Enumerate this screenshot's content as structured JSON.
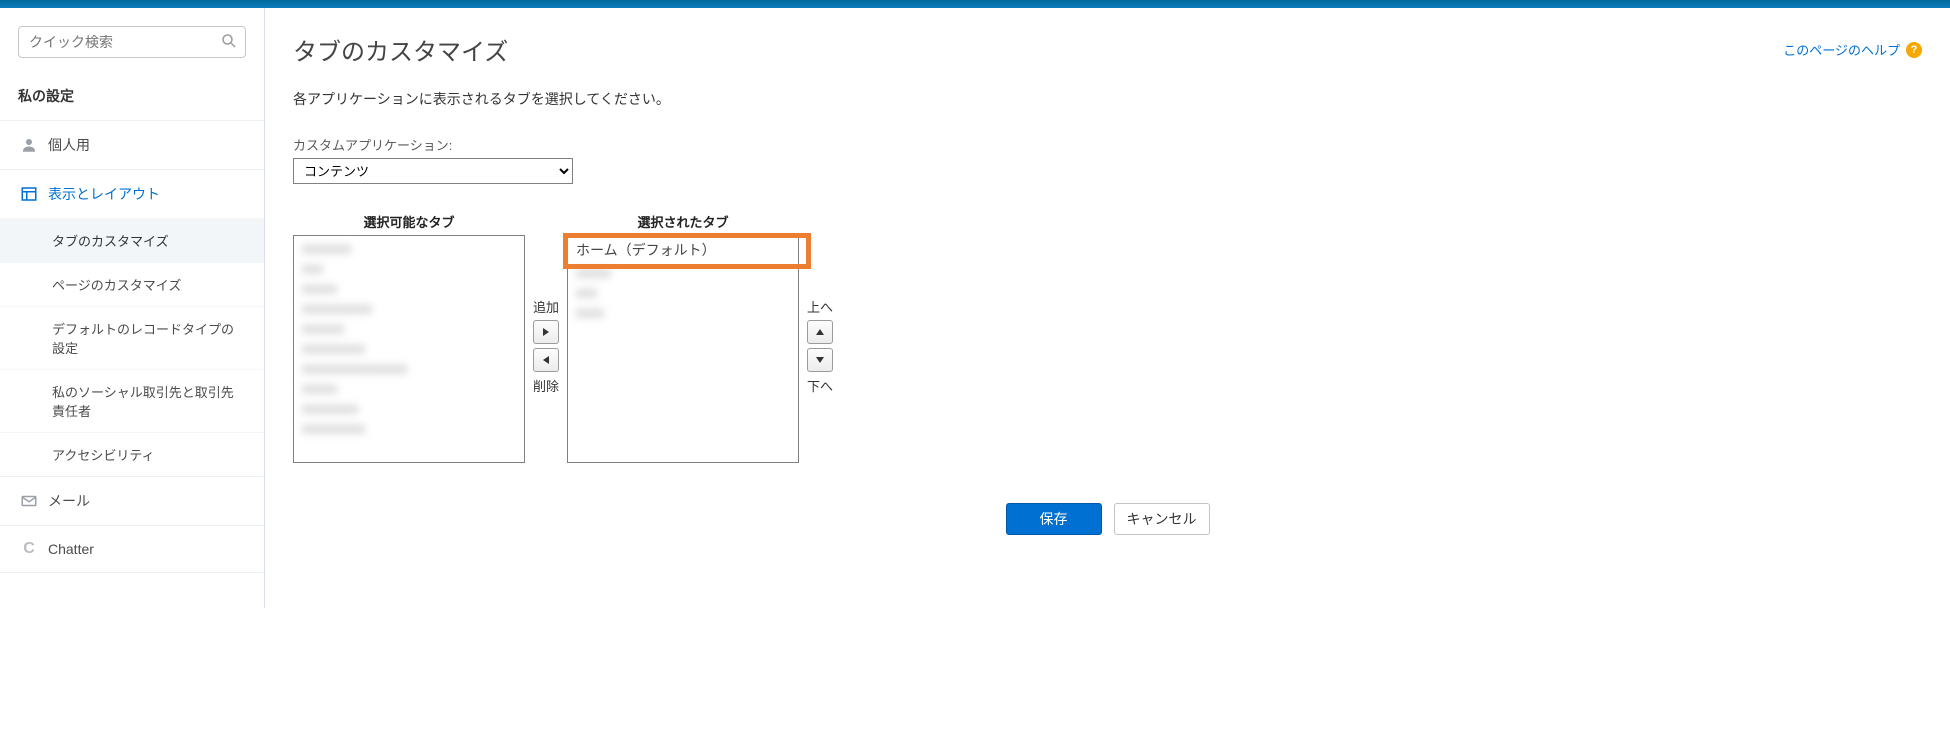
{
  "search": {
    "placeholder": "クイック検索"
  },
  "sidebar": {
    "title": "私の設定",
    "items": [
      {
        "label": "個人用"
      },
      {
        "label": "表示とレイアウト"
      },
      {
        "label": "メール"
      },
      {
        "label": "Chatter"
      }
    ],
    "display_subitems": [
      {
        "label": "タブのカスタマイズ"
      },
      {
        "label": "ページのカスタマイズ"
      },
      {
        "label": "デフォルトのレコードタイプの設定"
      },
      {
        "label": "私のソーシャル取引先と取引先責任者"
      },
      {
        "label": "アクセシビリティ"
      }
    ]
  },
  "page": {
    "title": "タブのカスタマイズ",
    "help_label": "このページのヘルプ",
    "description": "各アプリケーションに表示されるタブを選択してください。",
    "app_label": "カスタムアプリケーション:",
    "app_selected": "コンテンツ"
  },
  "dual": {
    "available_header": "選択可能なタブ",
    "selected_header": "選択されたタブ",
    "add_label": "追加",
    "remove_label": "削除",
    "up_label": "上へ",
    "down_label": "下へ",
    "selected_first": "ホーム（デフォルト）"
  },
  "buttons": {
    "save": "保存",
    "cancel": "キャンセル"
  }
}
